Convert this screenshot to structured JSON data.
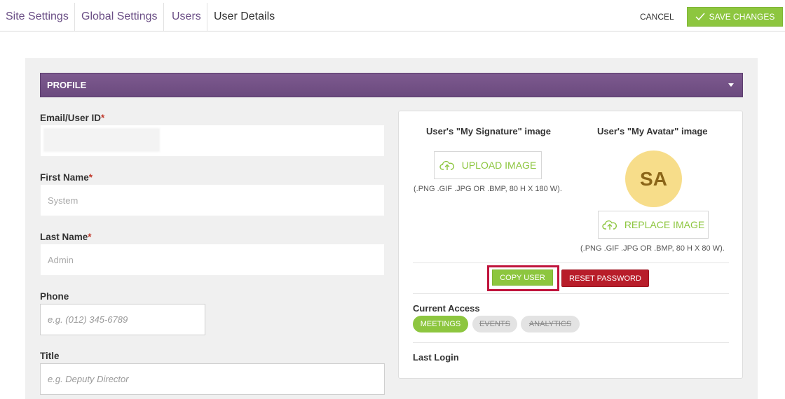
{
  "breadcrumbs": [
    {
      "label": "Site Settings"
    },
    {
      "label": "Global Settings"
    },
    {
      "label": "Users"
    },
    {
      "label": "User Details"
    }
  ],
  "toolbar": {
    "cancel_label": "CANCEL",
    "save_label": "SAVE CHANGES"
  },
  "colors": {
    "accent_green": "#8dc63f",
    "profile_purple": "#6b4a7e",
    "danger_red": "#b81d2a",
    "link_purple": "#6a4e85"
  },
  "section": {
    "title": "PROFILE"
  },
  "form": {
    "email_label": "Email/User ID",
    "email_value": "",
    "first_name_label": "First Name",
    "first_name_value": "System",
    "last_name_label": "Last Name",
    "last_name_value": "Admin",
    "phone_label": "Phone",
    "phone_placeholder": "e.g. (012) 345-6789",
    "title_label": "Title",
    "title_placeholder": "e.g. Deputy Director",
    "required_mark": "*"
  },
  "images": {
    "signature_heading": "User's \"My Signature\" image",
    "signature_button": "UPLOAD IMAGE",
    "signature_hint": "(.PNG .GIF .JPG OR .BMP, 80 H X 180 W).",
    "avatar_heading": "User's \"My Avatar\" image",
    "avatar_initials": "SA",
    "avatar_button": "REPLACE IMAGE",
    "avatar_hint": "(.PNG .GIF .JPG OR .BMP, 80 H X 80 W)."
  },
  "actions": {
    "copy_user": "COPY USER",
    "reset_password": "RESET PASSWORD"
  },
  "access": {
    "heading": "Current Access",
    "items": [
      {
        "label": "MEETINGS",
        "enabled": true
      },
      {
        "label": "EVENTS",
        "enabled": false
      },
      {
        "label": "ANALYTICS",
        "enabled": false
      }
    ]
  },
  "last_login": {
    "label": "Last Login"
  },
  "icons": {
    "save": "check-icon",
    "upload": "cloud-upload-icon",
    "dropdown": "caret-down-icon"
  }
}
